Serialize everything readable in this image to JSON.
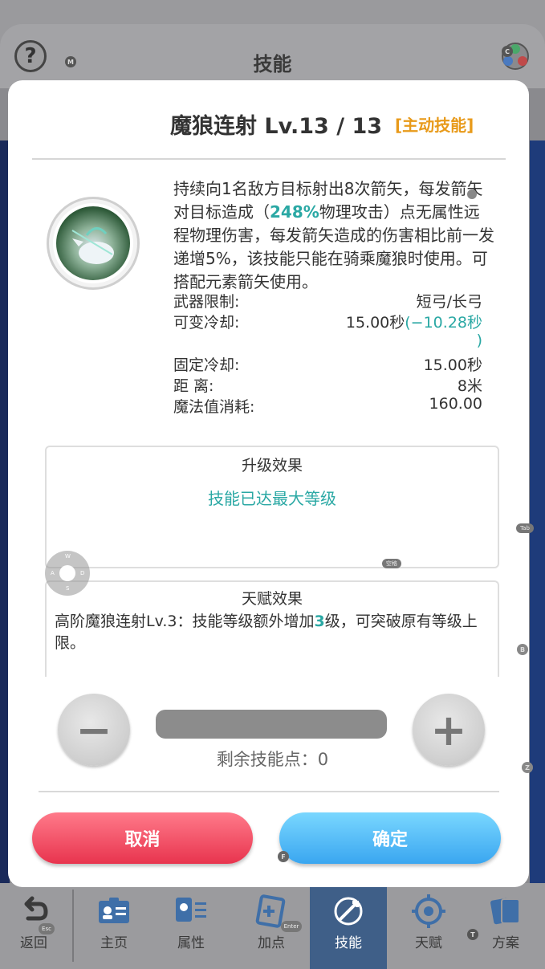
{
  "header": {
    "title": "技能",
    "help_symbol": "?",
    "help_hotkey": "M",
    "element_hotkey": "C"
  },
  "dialog": {
    "skill_name": "魔狼连射 Lv.13 / 13",
    "skill_type": "[主动技能]",
    "description": {
      "part1": "持续向1名敌方目标射出8次箭矢，每发箭矢对目标造成（",
      "highlight": "248%",
      "part2": "物理攻击）点无属性远程物理伤害，每发箭矢造成的伤害相比前一发递增5%，该技能只能在骑乘魔狼时使用。可搭配元素箭矢使用。"
    },
    "stats": {
      "weapon_label": "武器限制:",
      "weapon_value": "短弓/长弓",
      "var_cd_label": "可变冷却:",
      "var_cd_value": "15.00秒",
      "var_cd_bonus": "(−10.28秒",
      "var_cd_bonus_end": ")",
      "fixed_cd_label": "固定冷却:",
      "fixed_cd_value": "15.00秒",
      "range_label": "距 离:",
      "range_value": "8米",
      "mp_label": "魔法值消耗:",
      "mp_value": "160.00"
    },
    "upgrade": {
      "title": "升级效果",
      "message": "技能已达最大等级"
    },
    "talent": {
      "title": "天赋效果",
      "text_part1": "高阶魔狼连射Lv.3：技能等级额外增加",
      "text_highlight": "3",
      "text_part2": "级，可突破原有等级上限。"
    },
    "minus_symbol": "−",
    "plus_symbol": "+",
    "remaining_points": "剩余技能点：0",
    "cancel_label": "取消",
    "confirm_label": "确定"
  },
  "hotkeys": {
    "tab": "Tab",
    "space": "空格",
    "b": "B",
    "z": "Z",
    "f": "F",
    "esc": "Esc",
    "enter": "Enter",
    "t": "T",
    "wasd": [
      "W",
      "A",
      "S",
      "D"
    ]
  },
  "bottom_nav": [
    {
      "label": "返回",
      "icon": "back-arrow-icon"
    },
    {
      "label": "主页",
      "icon": "id-card-icon"
    },
    {
      "label": "属性",
      "icon": "profile-settings-icon"
    },
    {
      "label": "加点",
      "icon": "card-plus-icon"
    },
    {
      "label": "技能",
      "icon": "sword-skill-icon",
      "active": true
    },
    {
      "label": "天赋",
      "icon": "talent-target-icon"
    },
    {
      "label": "方案",
      "icon": "cards-plan-icon"
    }
  ],
  "colors": {
    "accent_teal": "#2aa8a4",
    "skill_tag_orange": "#e89a1a",
    "cancel_red": "#e8344e",
    "confirm_blue": "#3aa6f0",
    "nav_active": "#3f5f88"
  }
}
